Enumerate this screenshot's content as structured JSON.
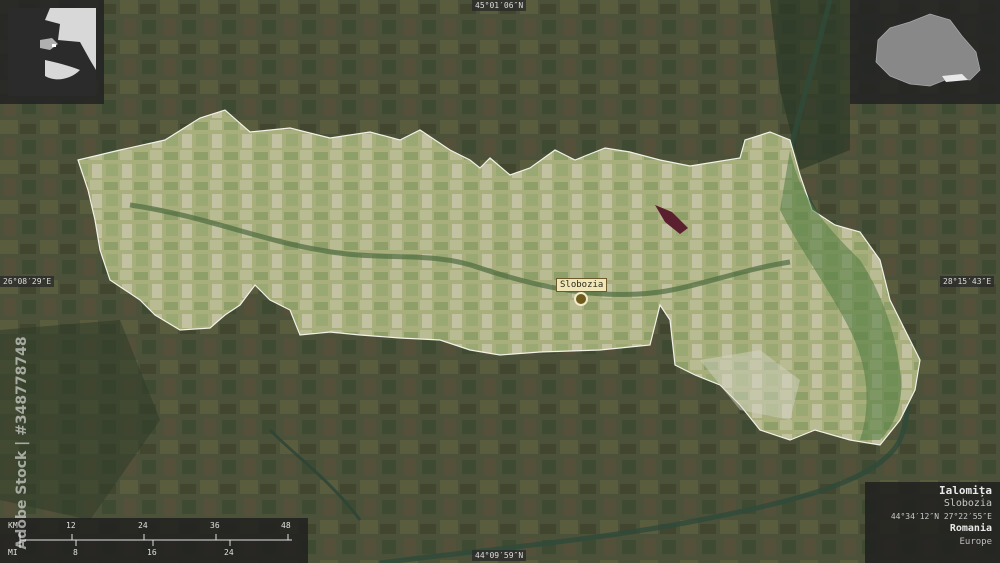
{
  "coordinates": {
    "top": "45°01′06″N",
    "bottom": "44°09′59″N",
    "left": "26°08′29″E",
    "right": "28°15′43″E"
  },
  "city": {
    "name": "Slobozia"
  },
  "info_box": {
    "region": "Ialomița",
    "capital": "Slobozia",
    "coords": "44°34′12″N 27°22′55″E",
    "country": "Romania",
    "continent": "Europe"
  },
  "scale_bar": {
    "km_unit": "KM",
    "km_ticks": [
      "12",
      "24",
      "36",
      "48"
    ],
    "mi_unit": "MI",
    "mi_ticks": [
      "8",
      "16",
      "24"
    ]
  },
  "watermark": {
    "text": "Adobe Stock | #348778748"
  },
  "colors": {
    "region_fill": "#a8b07a",
    "region_outline": "#f2f2e6",
    "terrain": "#4a4f38",
    "inset_region": "#888888",
    "inset_highlight": "#e8e8e8"
  }
}
